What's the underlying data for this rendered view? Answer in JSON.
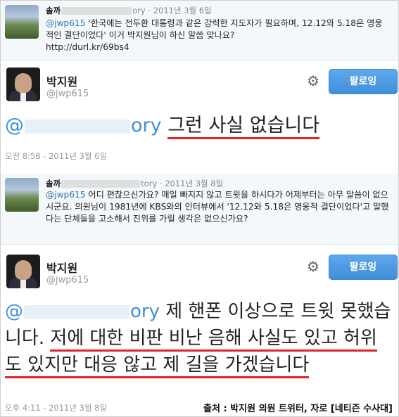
{
  "tweets": [
    {
      "reply": {
        "name": "솔까",
        "name_tail": "ory",
        "date": "· 2011년 3월 6일",
        "mention": "@jwp615",
        "text": " '한국에는 전두환 대통령과 같은 강력한 지도자가 필요하며, 12.12와 5.18은 영웅적인 결단이었다' 이거 박지원님이 하신 말씀 맞나요?",
        "link": "http://durl.kr/69bs4"
      },
      "main": {
        "name": "박지원",
        "handle": "@jwp615",
        "follow": "팔로잉",
        "mention_head": "@",
        "mention_tail": "ory",
        "body": "그런 사실 없습니다",
        "timestamp": "오전 8:58 - 2011년 3월 6일"
      }
    },
    {
      "reply": {
        "name": "솔까",
        "name_tail": "tory",
        "date": "· 2011년 3월 8일",
        "mention": "@jwp615",
        "text": " 어디 편찮으신가요? 매일 빠지지 않고 트윗을 하시다가 어제부터는 아무 말씀이 없으시군요. 의원님이 1981년에 KBS와의 인터뷰에서 '12.12와 5.18은 영웅적 결단이었다'고 말했다는 단체들을 고소해서 진위를 가릴 생각은 없으신가요?"
      },
      "main": {
        "name": "박지원",
        "handle": "@jwp615",
        "follow": "팔로잉",
        "mention_head": "@",
        "mention_tail": "ory",
        "body_plain": " 제 핸폰 이상으로 트윗 못했습니다. ",
        "body_underlined": "저에 대한 비판 비난 음해 사실도 있고 허위도 있지만 대응 않고 제 길을 가겠습니다",
        "timestamp": "오후 4:11 - 2011년 3월 8일"
      }
    }
  ],
  "source_caption": "출처 : 박지원 의원 트위터, 자로 [네티즌 수사대]",
  "icons": {
    "settings": "gear-icon"
  }
}
